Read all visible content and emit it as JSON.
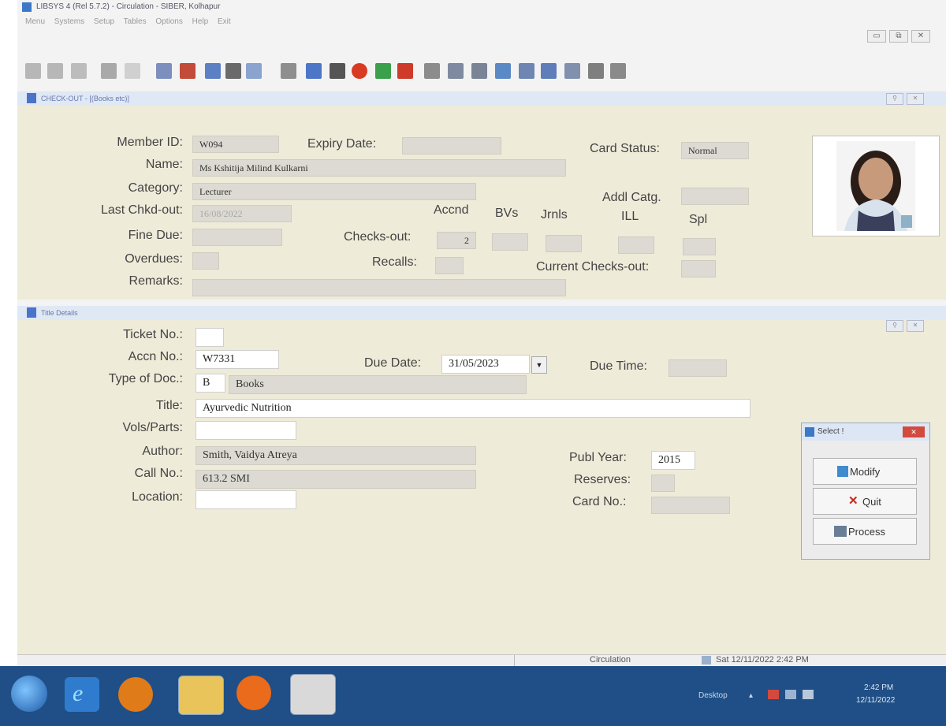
{
  "app": {
    "title": "LIBSYS 4 (Rel 5.7.2) - Circulation - SIBER, Kolhapur",
    "menu": [
      "Menu",
      "Systems",
      "Setup",
      "Tables",
      "Options",
      "Help",
      "Exit"
    ]
  },
  "checkout": {
    "window_title": "CHECK-OUT - [(Books etc)]",
    "labels": {
      "member_id": "Member ID:",
      "expiry_date": "Expiry Date:",
      "card_status": "Card Status:",
      "name": "Name:",
      "category": "Category:",
      "addl_catg": "Addl Catg.",
      "last_chkd_out": "Last Chkd-out:",
      "fine_due": "Fine Due:",
      "overdues": "Overdues:",
      "remarks": "Remarks:",
      "checks_out": "Checks-out:",
      "recalls": "Recalls:",
      "current_checks_out": "Current Checks-out:",
      "accnd": "Accnd",
      "bvs": "BVs",
      "jrnls": "Jrnls",
      "ill": "ILL",
      "spl": "Spl"
    },
    "values": {
      "member_id": "W094",
      "card_status": "Normal",
      "name": "Ms Kshitija Milind Kulkarni",
      "category": "Lecturer",
      "last_chkd_out": "16/08/2022",
      "checks_out_accnd": "2"
    }
  },
  "title_details": {
    "window_title": "Title Details",
    "labels": {
      "ticket_no": "Ticket No.:",
      "accn_no": "Accn No.:",
      "due_date": "Due Date:",
      "due_time": "Due Time:",
      "type_of_doc": "Type of Doc.:",
      "title": "Title:",
      "vols_parts": "Vols/Parts:",
      "author": "Author:",
      "publ_year": "Publ Year:",
      "call_no": "Call No.:",
      "reserves": "Reserves:",
      "location": "Location:",
      "card_no": "Card No.:"
    },
    "values": {
      "accn_no": "W7331",
      "due_date": "31/05/2023",
      "doc_code": "B",
      "doc_type": "Books",
      "title": "Ayurvedic Nutrition",
      "author": "Smith, Vaidya Atreya",
      "publ_year": "2015",
      "call_no": "613.2 SMI"
    }
  },
  "select_dialog": {
    "title": "Select !",
    "buttons": [
      "Modify",
      "Quit",
      "Process"
    ]
  },
  "statusbar": {
    "module": "Circulation",
    "datetime": "Sat 12/11/2022 2:42 PM"
  },
  "taskbar": {
    "desktop": "Desktop",
    "time": "2:42 PM",
    "date": "12/11/2022"
  }
}
